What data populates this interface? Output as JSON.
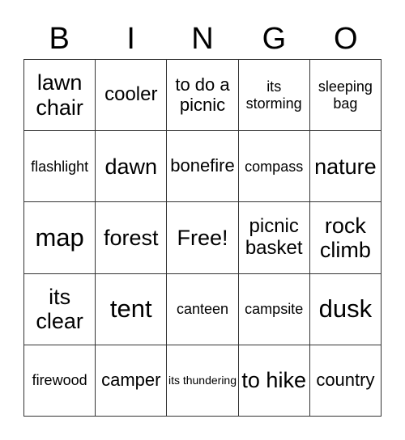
{
  "header": [
    "B",
    "I",
    "N",
    "G",
    "O"
  ],
  "cells": [
    {
      "text": "lawn chair",
      "size": "s-l"
    },
    {
      "text": "cooler",
      "size": "s-m"
    },
    {
      "text": "to do a picnic",
      "size": "s-ml"
    },
    {
      "text": "its storming",
      "size": "s-sm"
    },
    {
      "text": "sleeping bag",
      "size": "s-sm"
    },
    {
      "text": "flashlight",
      "size": "s-sm"
    },
    {
      "text": "dawn",
      "size": "s-l"
    },
    {
      "text": "bonefire",
      "size": "s-ml"
    },
    {
      "text": "compass",
      "size": "s-sm"
    },
    {
      "text": "nature",
      "size": "s-l"
    },
    {
      "text": "map",
      "size": "s-xl"
    },
    {
      "text": "forest",
      "size": "s-l"
    },
    {
      "text": "Free!",
      "size": "s-l"
    },
    {
      "text": "picnic basket",
      "size": "s-m"
    },
    {
      "text": "rock climb",
      "size": "s-l"
    },
    {
      "text": "its clear",
      "size": "s-l"
    },
    {
      "text": "tent",
      "size": "s-xl"
    },
    {
      "text": "canteen",
      "size": "s-sm"
    },
    {
      "text": "campsite",
      "size": "s-sm"
    },
    {
      "text": "dusk",
      "size": "s-xl"
    },
    {
      "text": "firewood",
      "size": "s-sm"
    },
    {
      "text": "camper",
      "size": "s-ml"
    },
    {
      "text": "its thundering",
      "size": "s-xs"
    },
    {
      "text": "to hike",
      "size": "s-l"
    },
    {
      "text": "country",
      "size": "s-ml"
    }
  ]
}
